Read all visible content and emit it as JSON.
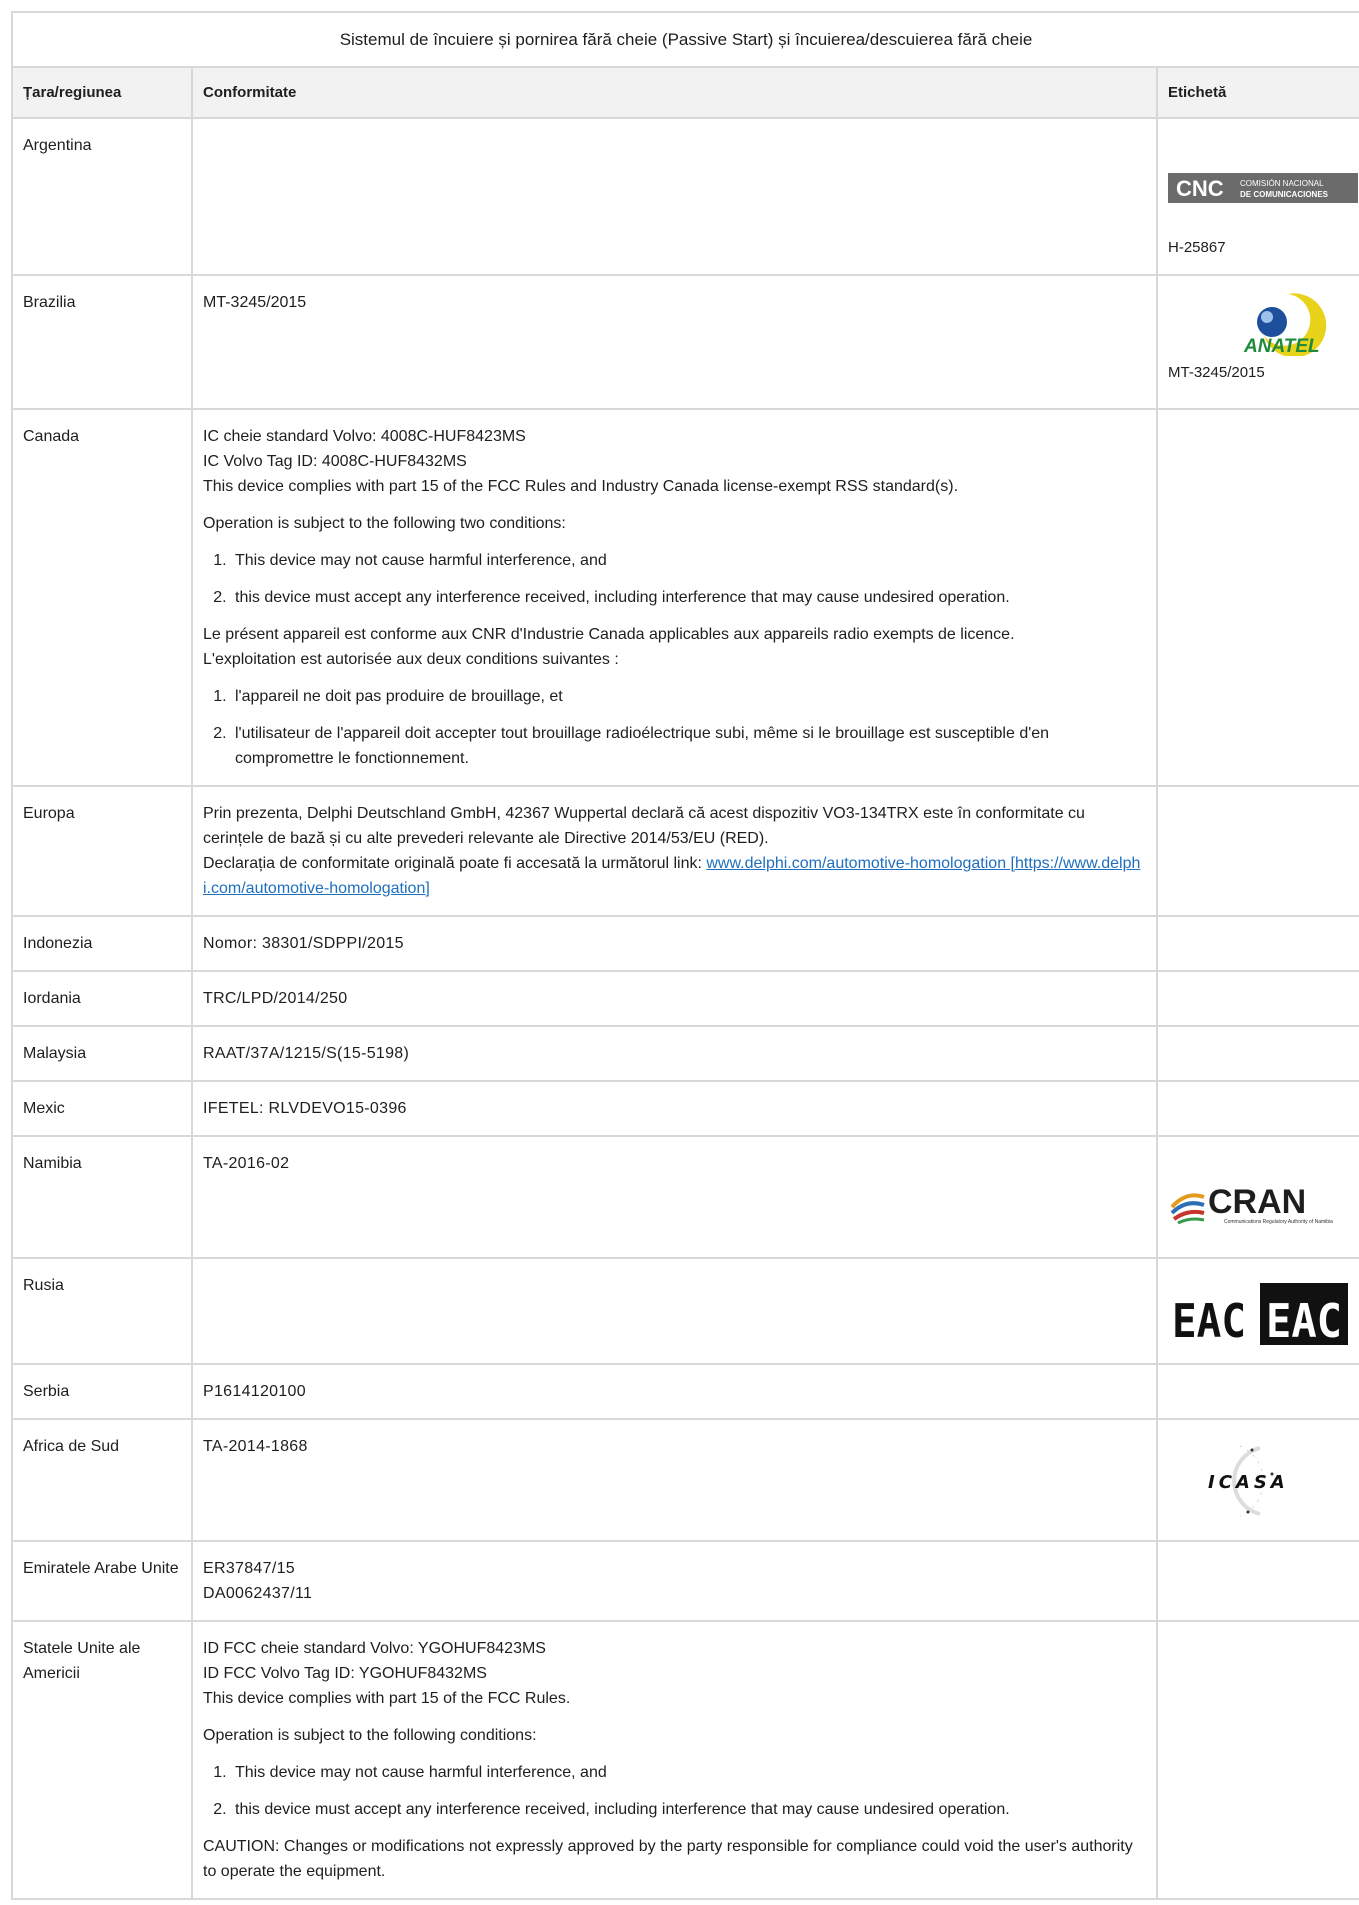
{
  "table": {
    "title": "Sistemul de încuiere și pornirea fără cheie (Passive Start) și încuierea/descuierea fără cheie",
    "headers": {
      "country": "Țara/regiunea",
      "compliance": "Conformitate",
      "label": "Etichetă"
    }
  },
  "rows": {
    "argentina": {
      "country": "Argentina",
      "label_text": "H-25867",
      "logo": {
        "big": "CNC",
        "line1": "COMISIÓN NACIONAL",
        "line2": "DE COMUNICACIONES"
      }
    },
    "brazil": {
      "country": "Brazilia",
      "compliance": "MT-3245/2015",
      "label_text": "MT-3245/2015",
      "logo": {
        "text": "ANATEL"
      }
    },
    "canada": {
      "country": "Canada",
      "line1": "IC cheie standard Volvo: 4008C-HUF8423MS",
      "line2": "IC Volvo Tag ID: 4008C-HUF8432MS",
      "line3": "This device complies with part 15 of the FCC Rules and Industry Canada license-exempt RSS standard(s).",
      "op": "Operation is subject to the following two conditions:",
      "li1": "This device may not cause harmful interference, and",
      "li2": "this device must accept any interference received, including interference that may cause undesired operation.",
      "fr1": "Le présent appareil est conforme aux CNR d'Industrie Canada applicables aux appareils radio exempts de licence.",
      "fr2": "L'exploitation est autorisée aux deux conditions suivantes :",
      "fli1": "l'appareil ne doit pas produire de brouillage, et",
      "fli2": "l'utilisateur de l'appareil doit accepter tout brouillage radioélectrique subi, même si le brouillage est susceptible d'en compromettre le fonctionnement."
    },
    "europe": {
      "country": "Europa",
      "text1": "Prin prezenta, Delphi Deutschland GmbH, 42367 Wuppertal declară că acest dispozitiv VO3-134TRX este în conformitate cu cerințele de bază și cu alte prevederi relevante ale Directive 2014/53/EU (RED).",
      "text2": "Declarația de conformitate originală poate fi accesată la următorul link: ",
      "link": "www.delphi.com/automotive-homologation [https://www.delphi.com/automotive-homologation]"
    },
    "indonesia": {
      "country": "Indonezia",
      "compliance": "Nomor: 38301/SDPPI/2015"
    },
    "jordan": {
      "country": "Iordania",
      "compliance": "TRC/LPD/2014/250"
    },
    "malaysia": {
      "country": "Malaysia",
      "compliance": "RAAT/37A/1215/S(15-5198)"
    },
    "mexico": {
      "country": "Mexic",
      "compliance": "IFETEL: RLVDEVO15-0396"
    },
    "namibia": {
      "country": "Namibia",
      "compliance": "TA-2016-02",
      "logo": {
        "text": "CRAN",
        "sub": "Communications Regulatory Authority of Namibia"
      }
    },
    "russia": {
      "country": "Rusia",
      "logo": {
        "text": "EAC"
      }
    },
    "serbia": {
      "country": "Serbia",
      "compliance": "P1614120100"
    },
    "southafrica": {
      "country": "Africa de Sud",
      "compliance": "TA-2014-1868",
      "logo": {
        "text": "ICASA"
      }
    },
    "uae": {
      "country": "Emiratele Arabe Unite",
      "line1": "ER37847/15",
      "line2": "DA0062437/11"
    },
    "usa": {
      "country": "Statele Unite ale Americii",
      "line1": "ID FCC cheie standard Volvo: YGOHUF8423MS",
      "line2": "ID FCC Volvo Tag ID: YGOHUF8432MS",
      "line3": "This device complies with part 15 of the FCC Rules.",
      "op": "Operation is subject to the following conditions:",
      "li1": "This device may not cause harmful interference, and",
      "li2": "this device must accept any interference received, including interference that may cause undesired operation.",
      "caution": "CAUTION: Changes or modifications not expressly approved by the party responsible for compliance could void the user's authority to operate the equipment."
    }
  },
  "colors": {
    "border": "#d8d8d8",
    "header_bg": "#f2f2f2",
    "link": "#1f6fbf",
    "anatel_yellow": "#e8d21a",
    "anatel_blue": "#1d4f9c",
    "anatel_green": "#1f8a3b",
    "cnc_bg": "#6b6b6b"
  }
}
